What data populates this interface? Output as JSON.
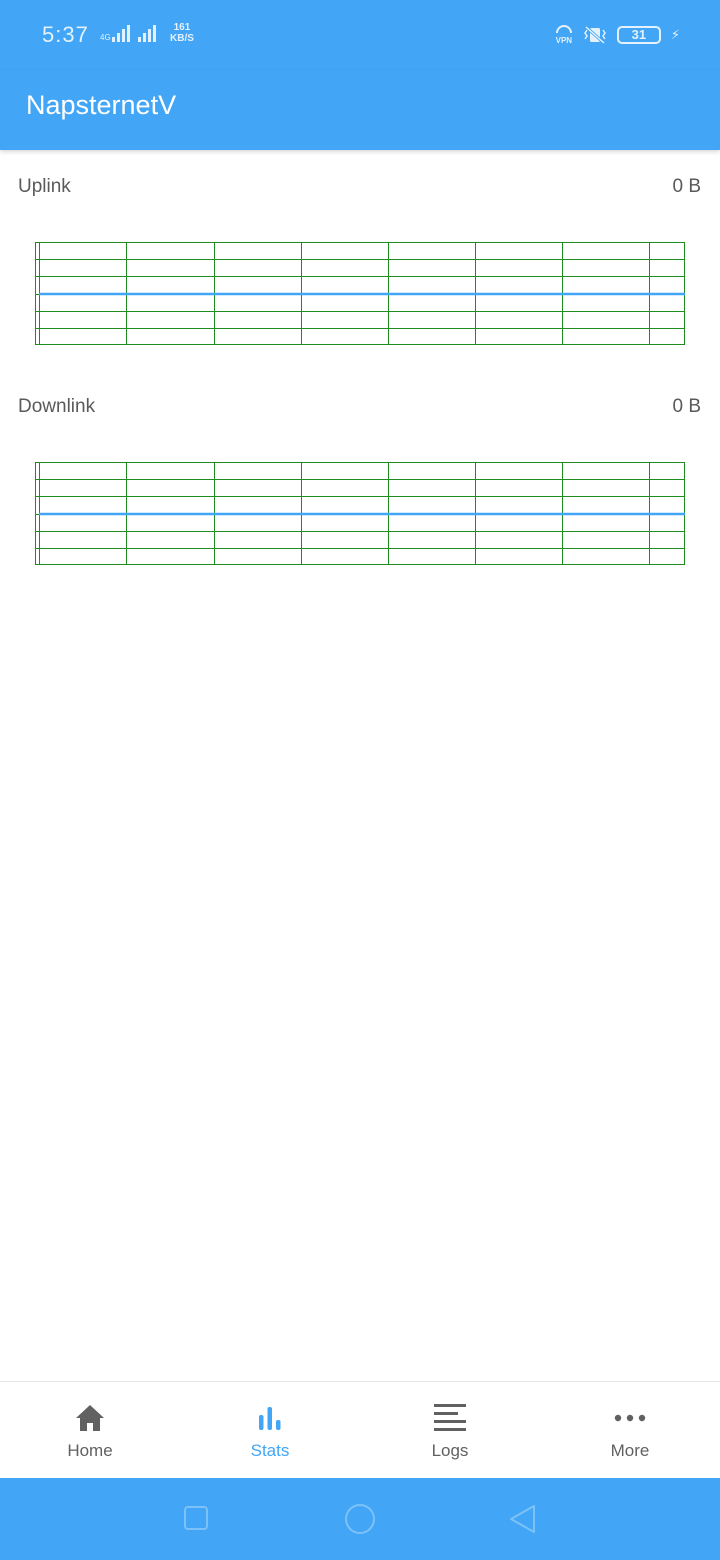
{
  "status_bar": {
    "time": "5:37",
    "network_type": "4G",
    "speed_value": "161",
    "speed_unit": "KB/S",
    "vpn_label": "VPN",
    "battery_level": "31"
  },
  "app_bar": {
    "title": "NapsternetV"
  },
  "stats": {
    "uplink": {
      "label": "Uplink",
      "value": "0 B"
    },
    "downlink": {
      "label": "Downlink",
      "value": "0 B"
    }
  },
  "chart_data": [
    {
      "type": "line",
      "title": "",
      "series": [
        {
          "values": [
            0,
            0,
            0,
            0,
            0,
            0,
            0,
            0,
            0
          ]
        }
      ],
      "grid": true
    },
    {
      "type": "line",
      "title": "",
      "series": [
        {
          "values": [
            0,
            0,
            0,
            0,
            0,
            0,
            0,
            0,
            0
          ]
        }
      ],
      "grid": true
    }
  ],
  "bottom_nav": {
    "items": [
      {
        "label": "Home",
        "icon": "home-icon"
      },
      {
        "label": "Stats",
        "icon": "bar-chart-icon",
        "active": true
      },
      {
        "label": "Logs",
        "icon": "logs-icon"
      },
      {
        "label": "More",
        "icon": "more-horizontal-icon"
      }
    ]
  },
  "colors": {
    "primary": "#42a5f5",
    "active_nav": "#42a5f5",
    "grid_line": "#1e8c1e",
    "series_line": "#42a5f5"
  },
  "system_nav": {
    "icons": [
      "recents-square-icon",
      "home-circle-icon",
      "back-triangle-icon"
    ]
  }
}
